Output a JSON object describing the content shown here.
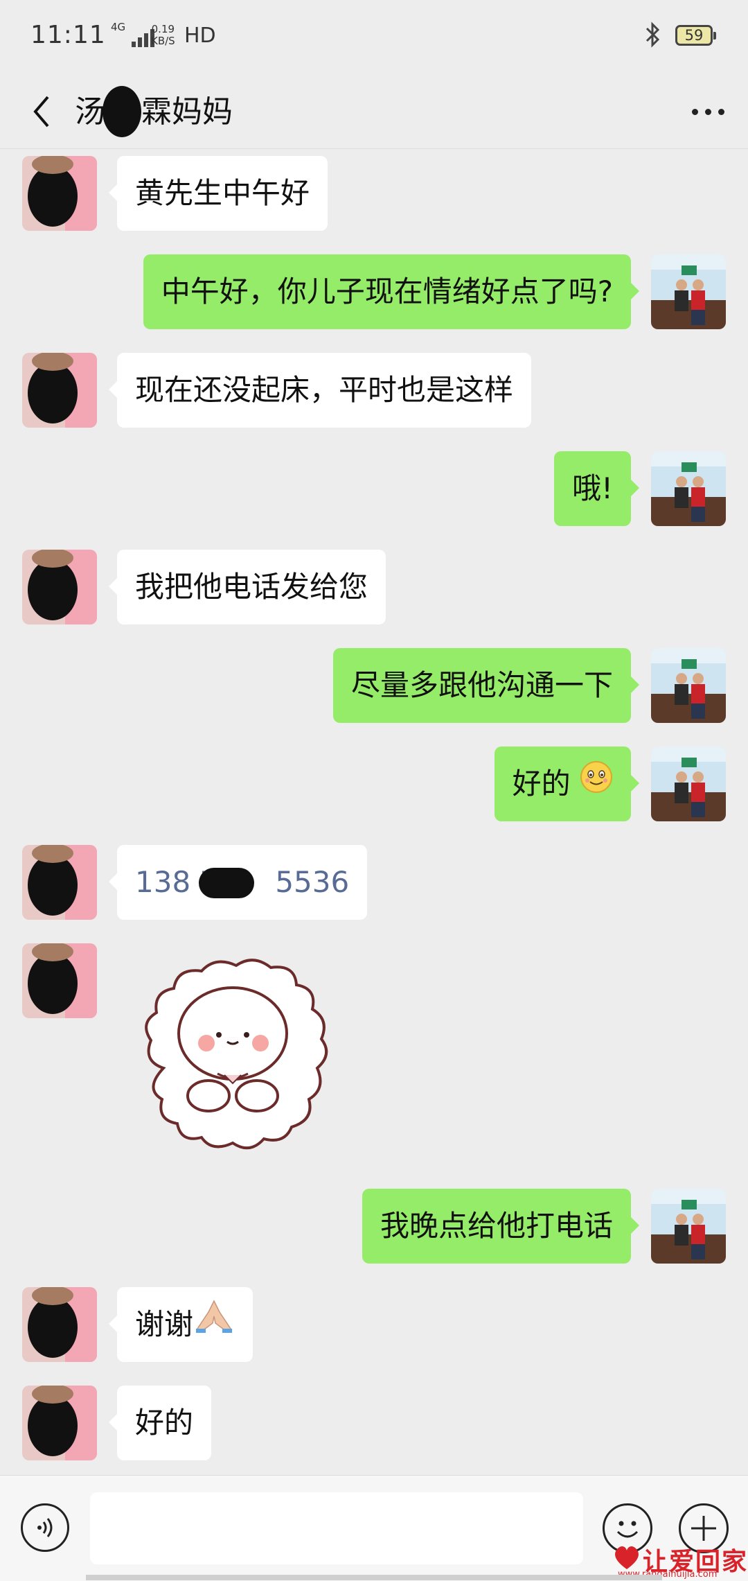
{
  "status_bar": {
    "time": "11:11",
    "network": "4G",
    "speed_value": "0.19",
    "speed_unit": "KB/S",
    "hd": "HD",
    "battery": "59"
  },
  "header": {
    "title_part1": "汤",
    "title_part2": "霖妈妈"
  },
  "messages": [
    {
      "side": "in",
      "text": "黄先生中午好"
    },
    {
      "side": "out",
      "text": "中午好，你儿子现在情绪好点了吗?"
    },
    {
      "side": "in",
      "text": "现在还没起床，平时也是这样"
    },
    {
      "side": "out",
      "text": "哦!"
    },
    {
      "side": "in",
      "text": "我把他电话发给您"
    },
    {
      "side": "out",
      "text": "尽量多跟他沟通一下"
    },
    {
      "side": "out",
      "text": "好的"
    },
    {
      "side": "in",
      "type": "phone",
      "part1": "138 7",
      "part2": "5536"
    },
    {
      "side": "in",
      "type": "sticker"
    },
    {
      "side": "out",
      "text": "我晚点给他打电话"
    },
    {
      "side": "in",
      "text": "谢谢"
    },
    {
      "side": "in",
      "text": "好的"
    }
  ],
  "input_bar": {
    "placeholder": ""
  },
  "watermark": {
    "text": "让爱回家",
    "url": "www.rangaihuijia.com"
  },
  "colors": {
    "outgoing_bubble": "#95ec69",
    "incoming_bubble": "#ffffff",
    "background": "#ededed",
    "phone_link": "#576b95"
  }
}
